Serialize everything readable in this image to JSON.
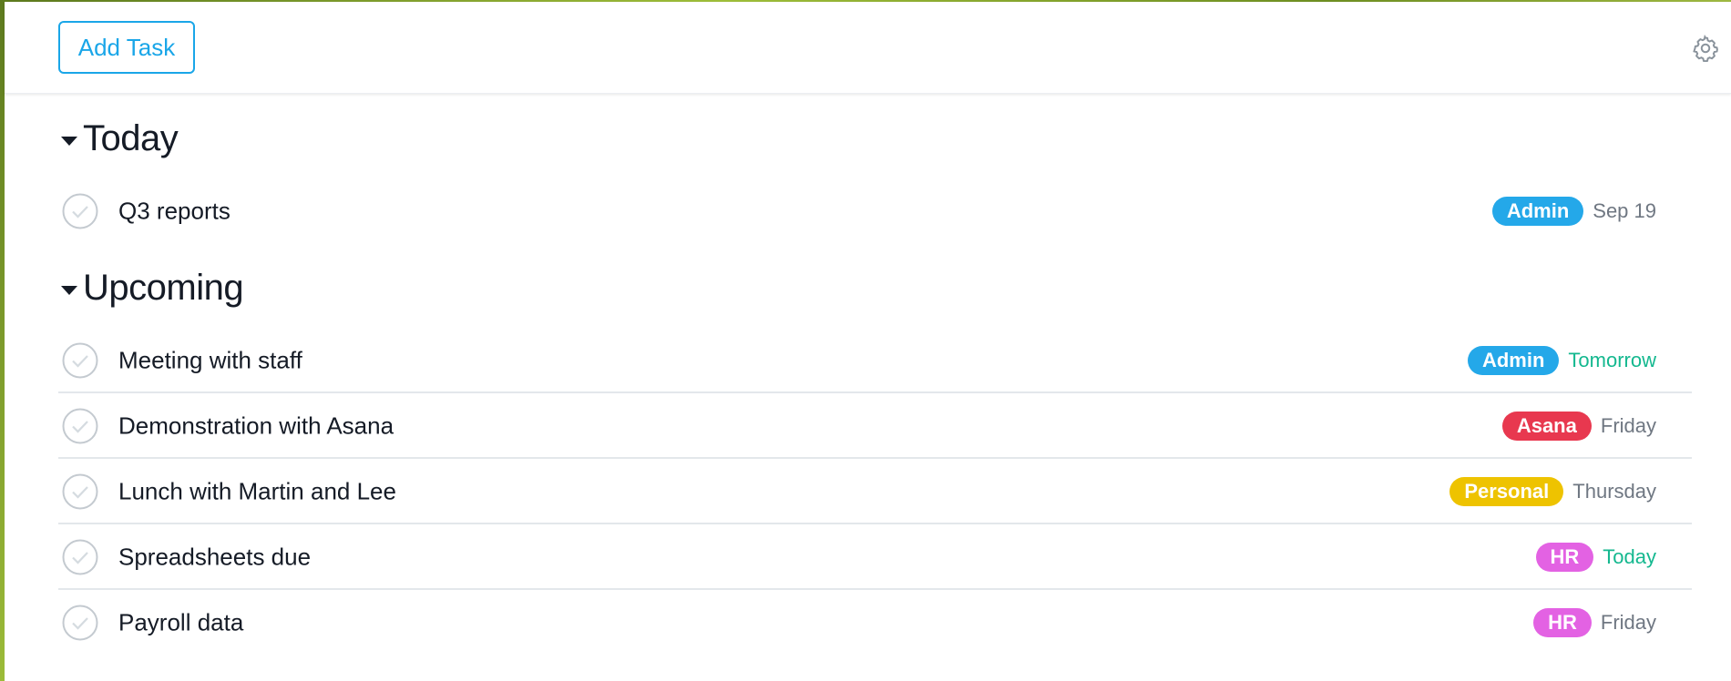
{
  "toolbar": {
    "add_task_label": "Add Task",
    "settings_icon": "gear-icon"
  },
  "sections": [
    {
      "title": "Today",
      "tasks": [
        {
          "name": "Q3 reports",
          "tag": "Admin",
          "tag_color": "#24a8e9",
          "due": "Sep 19",
          "due_color": "#6f7782"
        }
      ]
    },
    {
      "title": "Upcoming",
      "tasks": [
        {
          "name": "Meeting with staff",
          "tag": "Admin",
          "tag_color": "#24a8e9",
          "due": "Tomorrow",
          "due_color": "#14b88f"
        },
        {
          "name": "Demonstration with Asana",
          "tag": "Asana",
          "tag_color": "#e8384f",
          "due": "Friday",
          "due_color": "#6f7782"
        },
        {
          "name": "Lunch with Martin and Lee",
          "tag": "Personal",
          "tag_color": "#eec300",
          "due": "Thursday",
          "due_color": "#6f7782"
        },
        {
          "name": "Spreadsheets due",
          "tag": "HR",
          "tag_color": "#e362e3",
          "due": "Today",
          "due_color": "#14b88f"
        },
        {
          "name": "Payroll data",
          "tag": "HR",
          "tag_color": "#e362e3",
          "due": "Friday",
          "due_color": "#6f7782"
        }
      ]
    }
  ]
}
